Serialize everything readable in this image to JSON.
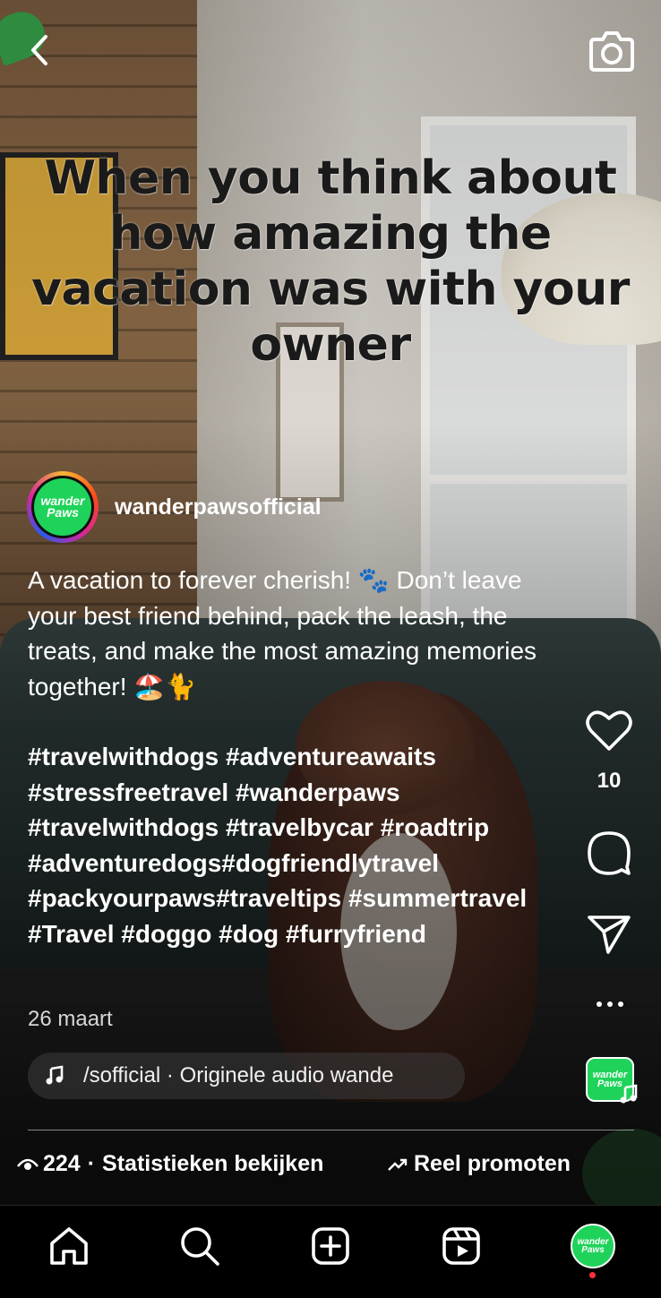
{
  "reel": {
    "overlay_text": "When you think about how amazing the vacation was with your owner",
    "username": "wanderpawsofficial",
    "avatar_text": "wander Paws",
    "caption": "A vacation to forever cherish! 🐾 Don’t leave your best friend behind, pack the leash, the treats, and make the most amazing memories together! 🏖️🐈",
    "hashtags": "#travelwithdogs #adventureawaits #stressfreetravel #wanderpaws #travelwithdogs #travelbycar #roadtrip #adventuredogs#dogfriendlytravel #packyourpaws#traveltips #summertravel #Travel #doggo #dog #furryfriend",
    "date": "26 maart",
    "audio": "/sofficial · Originele audio    wande",
    "audio_thumb_text": "wander Paws"
  },
  "actions": {
    "like_count": "10",
    "icons": [
      "heart-icon",
      "comment-icon",
      "share-icon",
      "more-icon"
    ]
  },
  "insights": {
    "views": "224",
    "stats_label": "Statistieken bekijken",
    "separator": "·",
    "promote_label": "Reel promoten"
  },
  "nav": {
    "tabs": [
      "home-icon",
      "search-icon",
      "create-icon",
      "reels-icon",
      "profile-avatar"
    ],
    "profile_avatar_text": "wander Paws"
  },
  "colors": {
    "brand_green": "#1fd35a",
    "notification_red": "#ff3040"
  }
}
